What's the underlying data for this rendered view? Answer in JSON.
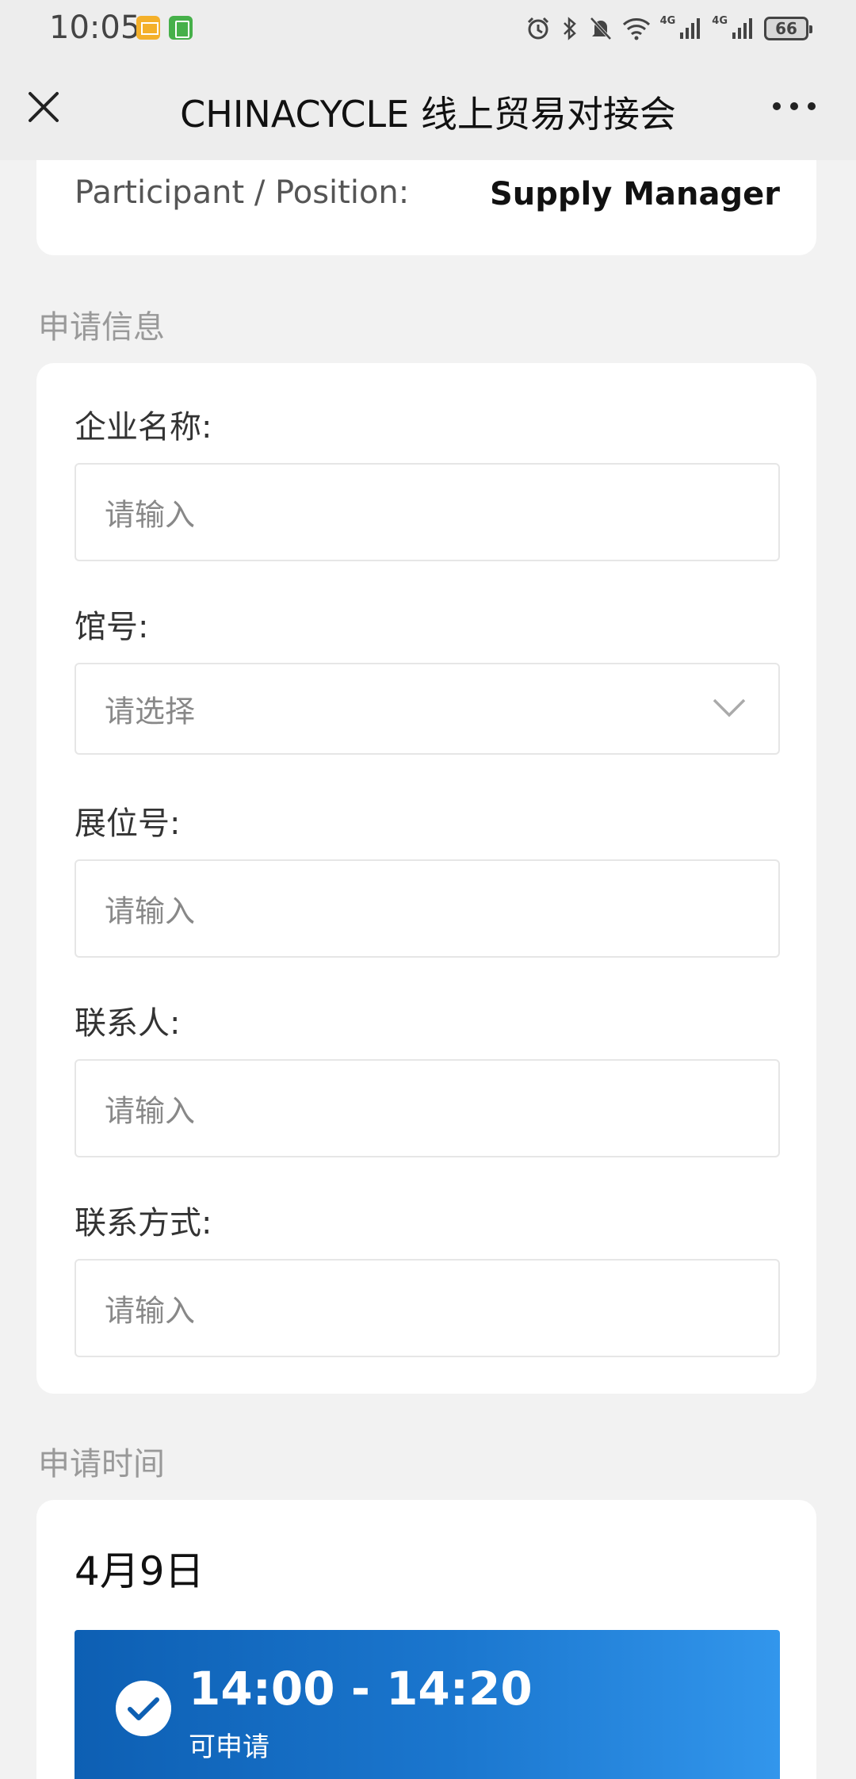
{
  "status_bar": {
    "time": "10:05",
    "network_1": "4G",
    "network_2": "4G",
    "battery": "66"
  },
  "nav": {
    "title": "CHINACYCLE 线上贸易对接会"
  },
  "participant": {
    "label": "Participant / Position:",
    "value": "Supply Manager"
  },
  "application_info": {
    "section_title": "申请信息",
    "fields": [
      {
        "label": "企业名称:",
        "placeholder": "请输入"
      },
      {
        "label": "馆号:",
        "placeholder": "请选择"
      },
      {
        "label": "展位号:",
        "placeholder": "请输入"
      },
      {
        "label": "联系人:",
        "placeholder": "请输入"
      },
      {
        "label": "联系方式:",
        "placeholder": "请输入"
      }
    ]
  },
  "application_time": {
    "section_title": "申请时间",
    "date": "4月9日",
    "slots": [
      {
        "time": "14:00 - 14:20",
        "status": "可申请",
        "selected": true
      }
    ]
  },
  "colors": {
    "accent": "#1b77cf",
    "background": "#f2f2f2"
  }
}
